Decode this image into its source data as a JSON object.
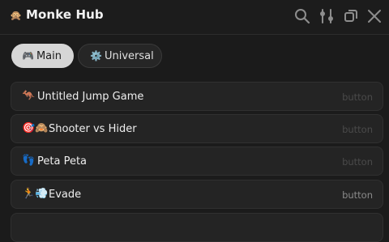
{
  "app": {
    "title": "Monke Hub",
    "icon": "monkey-face-icon"
  },
  "titlebar": {
    "icons": [
      "search-icon",
      "sliders-icon",
      "restore-window-icon",
      "close-icon"
    ]
  },
  "tabs": [
    {
      "label": "Main",
      "icon": "gamepad-icon",
      "active": true
    },
    {
      "label": "Universal",
      "icon": "gear-icon",
      "active": false
    }
  ],
  "items": [
    {
      "label": "Untitled Jump Game",
      "emoji": "🦘",
      "kind": "button"
    },
    {
      "label": "Shooter vs Hider",
      "emoji": "🎯🙈",
      "kind": "button"
    },
    {
      "label": "Peta Peta",
      "emoji": "👣",
      "kind": "button"
    },
    {
      "label": "Evade",
      "emoji": "🏃💨",
      "kind": "button"
    }
  ],
  "colors": {
    "background": "#1b1b1b",
    "row": "#242424",
    "active_tab": "#d6d6d6"
  }
}
